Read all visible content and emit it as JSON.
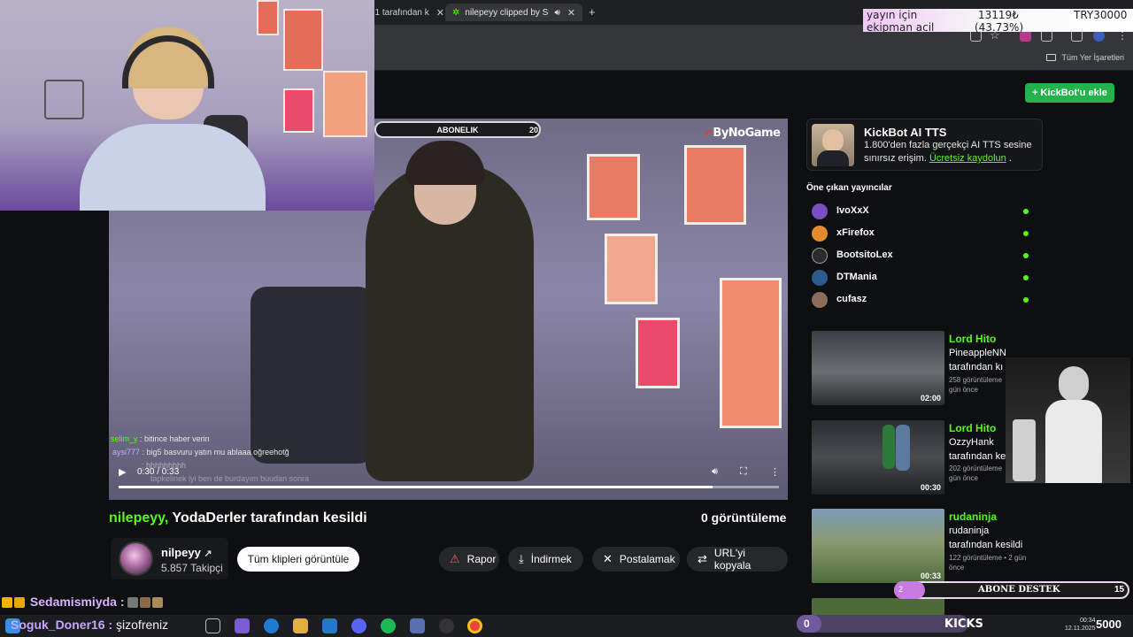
{
  "browser": {
    "tabs": [
      {
        "label": "61 tarafından k",
        "active": false
      },
      {
        "label": "nilepeyy clipped by Sedam",
        "active": true
      }
    ],
    "new_tab": "+",
    "bookmarks_all": "Tüm Yer İşaretleri"
  },
  "donation_overlay": {
    "line1_left": "yayın için",
    "line1_mid": "13119₺",
    "line1_right": "TRY30000",
    "line2_left": "ekipman acil",
    "line2_mid": "(43.73%)"
  },
  "video": {
    "sub_goal_label": "ABONELIK",
    "sub_goal_count": "20",
    "watermark": "ByNoGame",
    "chat_overlay": [
      {
        "user": "selim_y",
        "msg": ": bitince haber verin"
      },
      {
        "user": "aysi777",
        "msg": ": big5 basvuru yatın mu ablaaa oğreehotğ"
      },
      {
        "user": "",
        "msg": ": hhhhhhhhh"
      },
      {
        "user": "",
        "msg": "tapkelinek iyi ben de burdayım buudan sonra"
      }
    ],
    "time": "0:30 / 0:33",
    "progress": 0.9
  },
  "clip": {
    "username": "nilepeyy,",
    "title_rest": " YodaDerler tarafından kesildi",
    "views": "0 görüntüleme"
  },
  "channel": {
    "name": "nilpeyy",
    "followers": "5.857 Takipçi",
    "all_clips": "Tüm klipleri görüntüle"
  },
  "actions": [
    {
      "label": "Rapor",
      "icon": "⚠"
    },
    {
      "label": "İndirmek",
      "icon": "⤓"
    },
    {
      "label": "Postalamak",
      "icon": "✕"
    },
    {
      "label": "URL'yi kopyala",
      "icon": "⇄"
    }
  ],
  "sidebar": {
    "kickbot_button": "+ KickBot'u ekle",
    "tts": {
      "title": "KickBot AI TTS",
      "desc": "1.800'den fazla gerçekçi AI TTS sesine sınırsız erişim. ",
      "link": "Ücretsiz kaydolun",
      "suffix": " ."
    },
    "featured_heading": "Öne çıkan yayıncılar",
    "streamers": [
      "IvoXxX",
      "xFirefox",
      "BootsitoLex",
      "DTMania",
      "cufasz"
    ],
    "clips": [
      {
        "user": "Lord Hito",
        "line1": "PineappleNN",
        "line2": "tarafından kı",
        "meta1": "258 görüntüleme",
        "meta2": "gün önce",
        "duration": "02:00"
      },
      {
        "user": "Lord Hito",
        "line1": "OzzyHank",
        "line2": "tarafından ke",
        "meta1": "202 görüntüleme",
        "meta2": "gün önce",
        "duration": "00:30"
      },
      {
        "user": "rudaninja",
        "line1": "rudaninja",
        "line2": "tarafından kesildi",
        "meta1": "122 görüntüleme • 2 gün",
        "meta2": "önce",
        "duration": "00:33"
      }
    ]
  },
  "abone_destek": {
    "current": "2",
    "label": "ABONE DESTEK",
    "max": "15",
    "fraction": 0.13
  },
  "stream_chat": [
    {
      "user": "Sedamismiyda :",
      "msg": ""
    },
    {
      "user": "Soguk_Doner16 :",
      "msg": " şizofreniz"
    }
  ],
  "kicks_goal": {
    "current": "0",
    "label": "KICKS",
    "max": "5000",
    "fraction": 0.0
  },
  "clock": {
    "time": "00:34",
    "date": "12.11.2025"
  },
  "colors": {
    "kick_green": "#53fc18",
    "button_green": "#24b34b",
    "background": "#0e0f11"
  }
}
